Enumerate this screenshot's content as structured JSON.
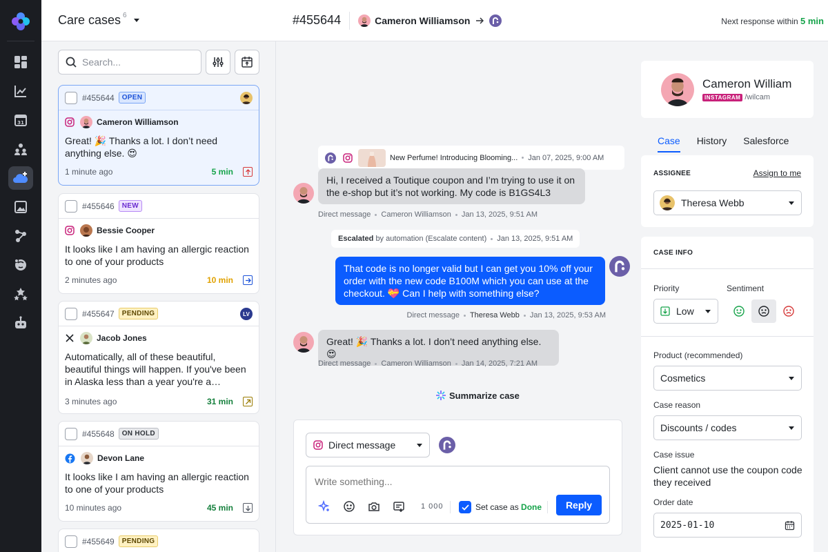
{
  "list": {
    "title": "Care cases",
    "count": "6",
    "search_placeholder": "Search...",
    "cases": [
      {
        "id": "#455644",
        "status": "OPEN",
        "customer": "Cameron Williamson",
        "channel": "instagram",
        "message": "Great! 🎉 Thanks a lot. I don’t need anything else. 😍",
        "ago": "1 minute ago",
        "sla": "5 min",
        "sla_color": "#16a34a"
      },
      {
        "id": "#455646",
        "status": "NEW",
        "customer": "Bessie Cooper",
        "channel": "instagram",
        "message": "It looks like I am having an allergic reaction to one of your products",
        "ago": "2 minutes ago",
        "sla": "10 min",
        "sla_color": "#e0a100"
      },
      {
        "id": "#455647",
        "status": "PENDING",
        "customer": "Jacob Jones",
        "channel": "x",
        "message": "Automatically, all of these beautiful, beautiful things will happen. If you've been in Alaska less than a year you're a Cheechako.",
        "ago": "3 minutes ago",
        "sla": "31 min",
        "sla_color": "#16803d",
        "agent_initials": "LV"
      },
      {
        "id": "#455648",
        "status": "ON HOLD",
        "customer": "Devon Lane",
        "channel": "facebook",
        "message": "It looks like I am having an allergic reaction to one of your products",
        "ago": "10 minutes ago",
        "sla": "45 min",
        "sla_color": "#16803d"
      },
      {
        "id": "#455649",
        "status": "PENDING"
      }
    ]
  },
  "header": {
    "case_id": "#455644",
    "customer": "Cameron Williamson",
    "next_response_label": "Next response within",
    "next_response_value": "5 min"
  },
  "thread": {
    "post_title": "New Perfume! Introducing Blooming...",
    "post_date": "Jan 07, 2025, 9:00 AM",
    "messages": [
      {
        "text": "Hi, I received a Toutique coupon and I’m trying to use it on the e-shop but it’s not working. My code is B1GS4L3",
        "channel": "Direct message",
        "author": "Cameron Williamson",
        "time": "Jan 13, 2025, 9:51 AM"
      },
      {
        "text": "That code is no longer valid but I can get you 10% off your order with the new code B100M which you can use at the checkout. 💝 Can I help with something else?",
        "channel": "Direct message",
        "author": "Theresa Webb",
        "time": "Jan 13, 2025, 9:53 AM"
      },
      {
        "text": "Great! 🎉 Thanks a lot. I don’t need anything else. 😍",
        "channel": "Direct message",
        "author": "Cameron Williamson",
        "time": "Jan 14, 2025, 7:21 AM"
      }
    ],
    "escalation": {
      "bold": "Escalated",
      "rest": "by automation (Escalate content)",
      "time": "Jan 13, 2025, 9:51 AM"
    },
    "summarize_label": "Summarize case"
  },
  "composer": {
    "channel": "Direct message",
    "placeholder": "Write something...",
    "char_limit": "1 000",
    "set_case_prefix": "Set case as",
    "set_case_status": "Done",
    "reply_label": "Reply"
  },
  "details": {
    "name": "Cameron William",
    "platform": "INSTAGRAM",
    "handle": "/wilcam",
    "tabs": [
      "Case",
      "History",
      "Salesforce"
    ],
    "assignee_title": "ASSIGNEE",
    "assign_to_me": "Assign to me",
    "assignee": "Theresa Webb",
    "case_info_title": "CASE INFO",
    "priority_label": "Priority",
    "priority": "Low",
    "sentiment_label": "Sentiment",
    "product_label": "Product (recommended)",
    "product": "Cosmetics",
    "reason_label": "Case reason",
    "reason": "Discounts / codes",
    "issue_label": "Case issue",
    "issue": "Client cannot use the coupon code they received",
    "order_date_label": "Order date",
    "order_date": "2025-01-10"
  },
  "colors": {
    "accent": "#0b5cff",
    "rail": "#1b1d22",
    "success": "#16a34a",
    "instagram": "#c8217a"
  }
}
